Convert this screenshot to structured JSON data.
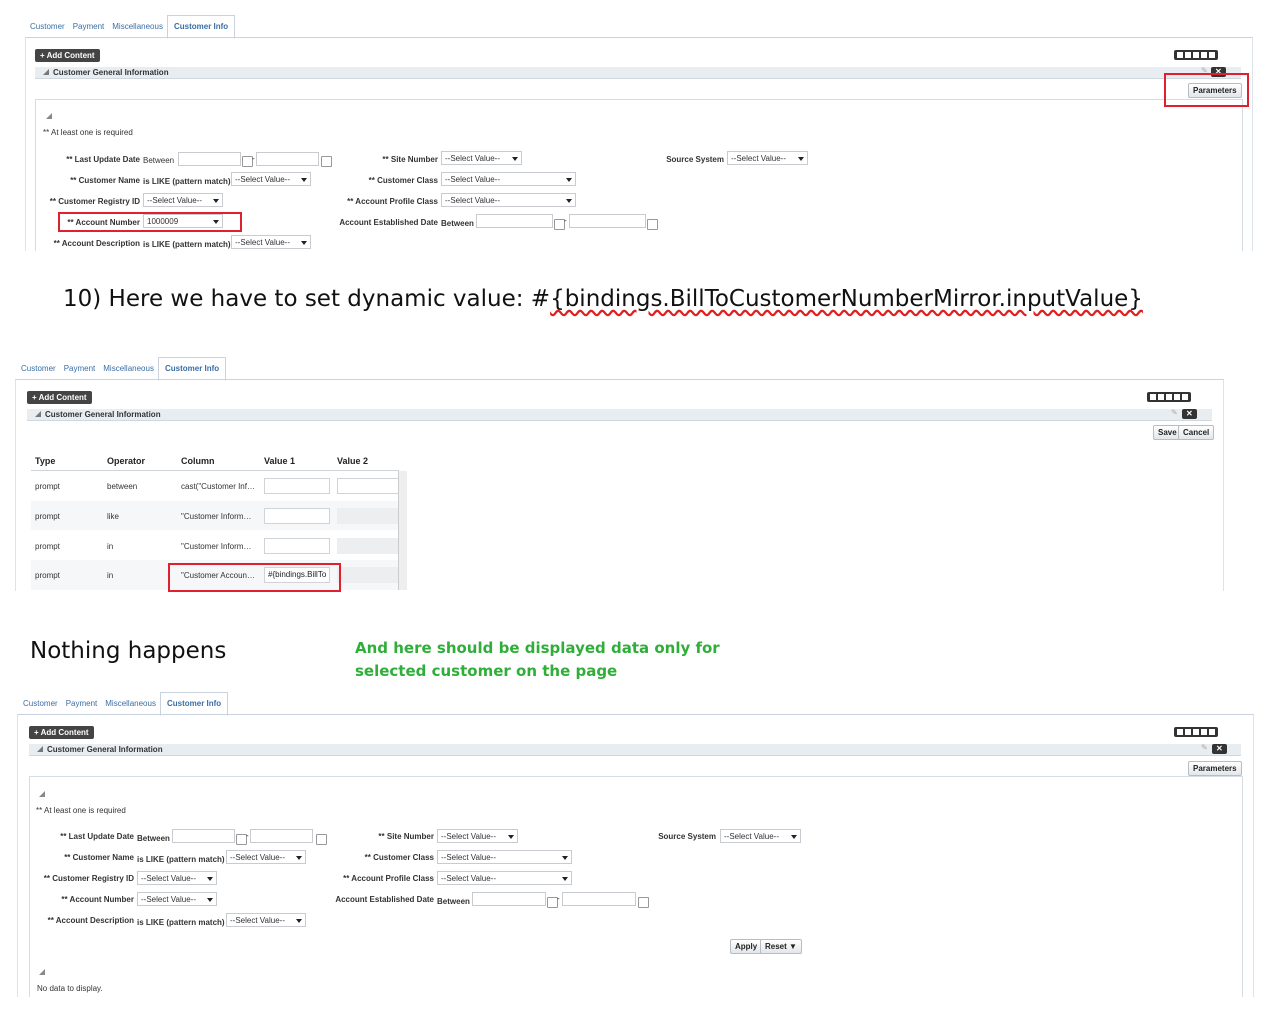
{
  "tabs": [
    "Customer",
    "Payment",
    "Miscellaneous",
    "Customer Info"
  ],
  "add_content": "+ Add Content",
  "panel_title": "Customer General Information",
  "parameters_label": "Parameters",
  "save_label": "Save",
  "cancel_label": "Cancel",
  "apply_label": "Apply",
  "reset_label": "Reset ▼",
  "required_hint": "** At least one is required",
  "no_data": "No data to display.",
  "between": "Between",
  "like_op": "is LIKE (pattern match)",
  "select_value": "--Select Value--",
  "fields": {
    "last_update": "** Last Update Date",
    "customer_name": "** Customer Name",
    "registry_id": "** Customer Registry ID",
    "account_number": "** Account Number",
    "account_description": "** Account Description",
    "site_number": "** Site Number",
    "customer_class": "** Customer Class",
    "account_profile_class": "** Account Profile Class",
    "account_established": "Account Established Date",
    "source_system": "Source System"
  },
  "account_number_value": "1000009",
  "step_text_prefix": "10)  Here we have to set dynamic value: #",
  "step_text_expr": "{bindings.BillToCustomerNumberMirror.inputValue}",
  "nothing_happens": "Nothing happens",
  "green_note_line1": "And here should be displayed data only for",
  "green_note_line2": "selected customer on the page",
  "grid": {
    "headers": [
      "Type",
      "Operator",
      "Column",
      "Value 1",
      "Value 2"
    ],
    "rows": [
      {
        "type": "prompt",
        "operator": "between",
        "column": "cast(\"Customer Inf…",
        "value1": ""
      },
      {
        "type": "prompt",
        "operator": "like",
        "column": "\"Customer Inform…",
        "value1": ""
      },
      {
        "type": "prompt",
        "operator": "in",
        "column": "\"Customer Inform…",
        "value1": ""
      },
      {
        "type": "prompt",
        "operator": "in",
        "column": "\"Customer Accoun…",
        "value1": "#{bindings.BillTo"
      }
    ]
  }
}
